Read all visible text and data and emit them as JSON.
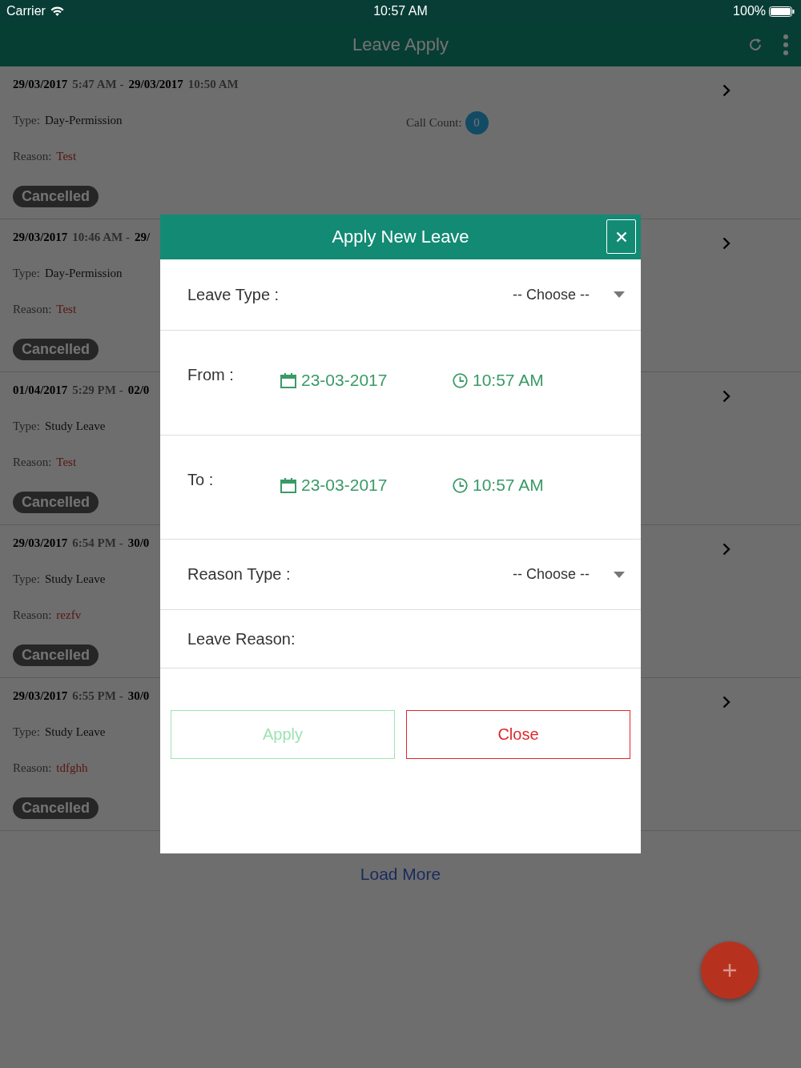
{
  "status_bar": {
    "carrier": "Carrier",
    "time": "10:57 AM",
    "battery": "100%"
  },
  "header": {
    "title": "Leave Apply"
  },
  "leaves": [
    {
      "from_date": "29/03/2017",
      "from_time": "5:47 AM -",
      "to_date": "29/03/2017",
      "to_time": "10:50 AM",
      "type_label": "Type:",
      "type": "Day-Permission",
      "reason_label": "Reason:",
      "reason": "Test",
      "status": "Cancelled",
      "call_count": {
        "label": "Call Count:",
        "value": "0"
      }
    },
    {
      "from_date": "29/03/2017",
      "from_time": "10:46 AM -",
      "to_date": "29/",
      "type_label": "Type:",
      "type": "Day-Permission",
      "reason_label": "Reason:",
      "reason": "Test",
      "status": "Cancelled"
    },
    {
      "from_date": "01/04/2017",
      "from_time": "5:29 PM -",
      "to_date": "02/0",
      "type_label": "Type:",
      "type": "Study Leave",
      "reason_label": "Reason:",
      "reason": "Test",
      "status": "Cancelled"
    },
    {
      "from_date": "29/03/2017",
      "from_time": "6:54 PM -",
      "to_date": "30/0",
      "type_label": "Type:",
      "type": "Study Leave",
      "reason_label": "Reason:",
      "reason": "rezfv",
      "status": "Cancelled"
    },
    {
      "from_date": "29/03/2017",
      "from_time": "6:55 PM -",
      "to_date": "30/0",
      "type_label": "Type:",
      "type": "Study Leave",
      "reason_label": "Reason:",
      "reason": "tdfghh",
      "status": "Cancelled"
    }
  ],
  "load_more": "Load More",
  "dialog": {
    "title": "Apply New Leave",
    "leave_type": {
      "label": "Leave Type :",
      "value": "-- Choose --"
    },
    "from": {
      "label": "From :",
      "date": "23-03-2017",
      "time": "10:57 AM"
    },
    "to": {
      "label": "To :",
      "date": "23-03-2017",
      "time": "10:57 AM"
    },
    "reason_type": {
      "label": "Reason Type :",
      "value": "-- Choose --"
    },
    "leave_reason": {
      "label": "Leave Reason:"
    },
    "buttons": [
      {
        "label": "Apply",
        "kind": "apply",
        "disabled": true
      },
      {
        "label": "Close",
        "kind": "close",
        "disabled": false
      }
    ]
  }
}
